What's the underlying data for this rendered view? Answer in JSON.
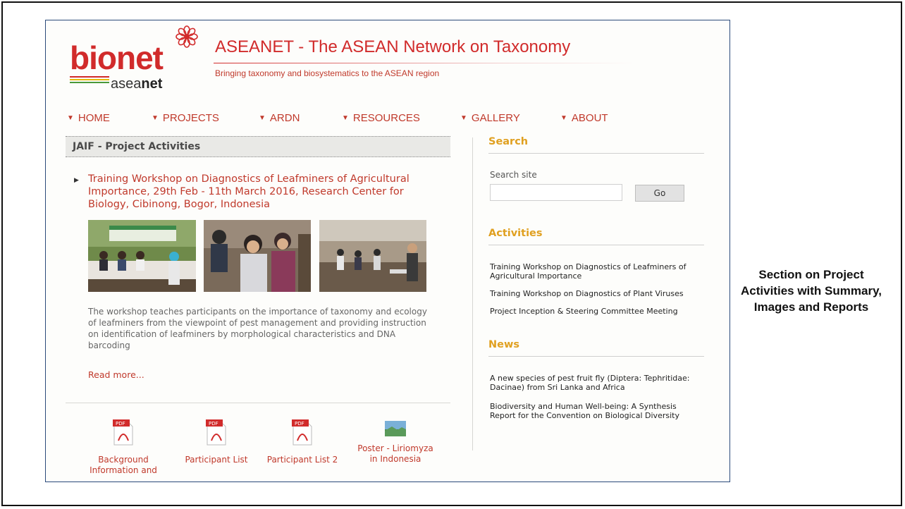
{
  "site": {
    "logo_main": "bionet",
    "logo_sub_light": "asea",
    "logo_sub_bold": "net",
    "title": "ASEANET - The ASEAN Network on Taxonomy",
    "tagline": "Bringing taxonomy and biosystematics to the ASEAN region"
  },
  "nav": {
    "items": [
      "HOME",
      "PROJECTS",
      "ARDN",
      "RESOURCES",
      "GALLERY",
      "ABOUT"
    ]
  },
  "main": {
    "section_heading": "JAIF - Project Activities",
    "article_title": "Training Workshop on Diagnostics of Leafminers of Agricultural Importance, 29th Feb - 11th March 2016, Research Center for Biology, Cibinong, Bogor, Indonesia",
    "summary": "The workshop teaches participants on the importance of taxonomy and ecology of leafminers from the viewpoint of pest management and providing instruction on identification of leafminers by morphological characteristics and DNA barcoding",
    "read_more": "Read more...",
    "attachments": [
      {
        "label": "Background Information and",
        "icon": "pdf-icon"
      },
      {
        "label": "Participant List",
        "icon": "pdf-icon"
      },
      {
        "label": "Participant List 2",
        "icon": "pdf-icon"
      },
      {
        "label": "Poster - Liriomyza in Indonesia",
        "icon": "image-icon"
      }
    ]
  },
  "sidebar": {
    "search_heading": "Search",
    "search_label": "Search site",
    "search_value": "",
    "go_label": "Go",
    "activities_heading": "Activities",
    "activities": [
      "Training Workshop on Diagnostics of Leafminers of Agricultural Importance",
      "Training Workshop on Diagnostics of Plant Viruses",
      "Project Inception & Steering Committee Meeting"
    ],
    "news_heading": "News",
    "news": [
      "A new species of pest fruit fly (Diptera: Tephritidae: Dacinae) from Sri Lanka and Africa",
      "Biodiversity and Human Well-being: A Synthesis Report for the Convention on Biological Diversity"
    ]
  },
  "caption": "Section on Project Activities with Summary, Images and Reports",
  "colors": {
    "brand_red": "#c0392b",
    "accent_gold": "#e0a020",
    "frame_blue": "#2a4a7a"
  }
}
